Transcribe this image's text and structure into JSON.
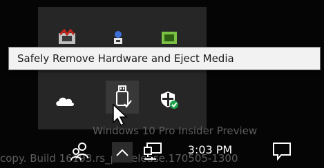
{
  "tooltip": {
    "text": "Safely Remove Hardware and Eject Media"
  },
  "watermark": {
    "line1": "Windows 10 Pro Insider Preview",
    "line2": "copy. Build 16193.rs_prerelease.170505-1300"
  },
  "taskbar": {
    "time": "3:03 PM"
  },
  "tray_icons": {
    "row1": [
      "media-app-icon",
      "network-vpn-icon",
      "graphics-card-icon"
    ],
    "row2": [
      "onedrive-cloud-icon",
      "usb-drive-eject-icon",
      "windows-defender-shield-icon"
    ]
  },
  "colors": {
    "popup_bg": "#262626",
    "tooltip_bg": "#f2f2f2",
    "defender_check": "#1fa24b",
    "graphics_green": "#7ac143"
  }
}
